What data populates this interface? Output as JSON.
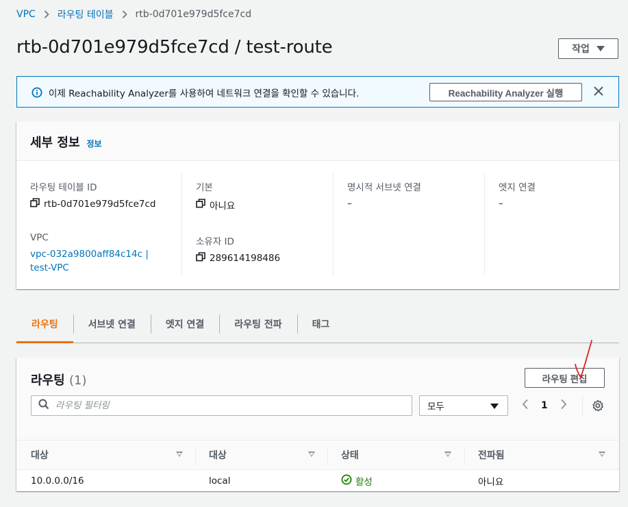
{
  "breadcrumb": {
    "vpc": "VPC",
    "route_tables": "라우팅 테이블",
    "current": "rtb-0d701e979d5fce7cd"
  },
  "page": {
    "title": "rtb-0d701e979d5fce7cd / test-route",
    "actions_label": "작업"
  },
  "flash": {
    "message": "이제 Reachability Analyzer를 사용하여 네트워크 연결을 확인할 수 있습니다.",
    "button_label": "Reachability Analyzer 실행"
  },
  "details": {
    "title": "세부 정보",
    "info_link": "정보",
    "route_table_id_label": "라우팅 테이블 ID",
    "route_table_id": "rtb-0d701e979d5fce7cd",
    "vpc_label": "VPC",
    "vpc_value_line1": "vpc-032a9800aff84c14c |",
    "vpc_value_line2": "test-VPC",
    "main_label": "기본",
    "main_value": "아니요",
    "owner_label": "소유자 ID",
    "owner_value": "289614198486",
    "explicit_label": "명시적 서브넷 연결",
    "explicit_value": "–",
    "edge_label": "엣지 연결",
    "edge_value": "–"
  },
  "tabs": [
    "라우팅",
    "서브넷 연결",
    "엣지 연결",
    "라우팅 전파",
    "태그"
  ],
  "routes": {
    "title": "라우팅",
    "count": "(1)",
    "edit_label": "라우팅 편집",
    "filter_placeholder": "라우팅 필터링",
    "select_value": "모두",
    "page_number": "1",
    "columns": [
      "대상",
      "대상",
      "상태",
      "전파됨"
    ],
    "rows": [
      {
        "destination": "10.0.0.0/16",
        "target": "local",
        "status": "활성",
        "propagated": "아니요"
      }
    ]
  },
  "colors": {
    "accent": "#ec7211",
    "link": "#0073bb",
    "success": "#1d8102",
    "annotation": "#e02020"
  }
}
